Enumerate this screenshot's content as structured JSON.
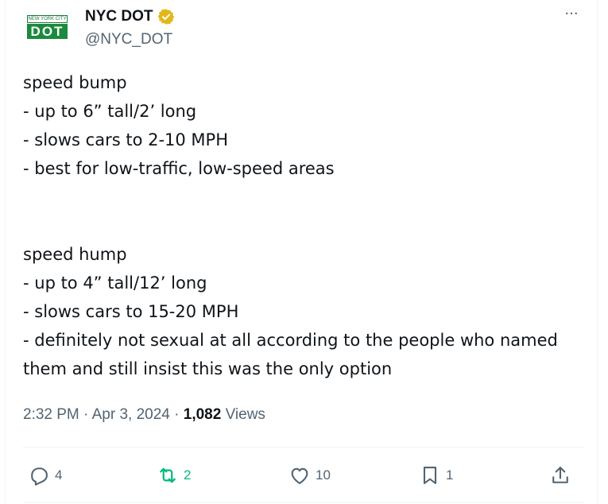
{
  "author": {
    "display_name": "NYC DOT",
    "handle": "@NYC_DOT",
    "verified_icon": "verified-badge-icon",
    "verified_color": "#e2b719",
    "avatar": {
      "top_text": "NEW YORK CITY",
      "bottom_text": "DOT"
    }
  },
  "more_label": "···",
  "tweet": {
    "text": "speed bump\n- up to 6” tall/2’ long\n- slows cars to 2-10 MPH\n- best for low-traffic, low-speed areas\n\n\nspeed hump\n- up to 4” tall/12’ long\n- slows cars to 15-20 MPH\n- definitely not sexual at all according to the people who named them and still insist this was the only option"
  },
  "meta": {
    "time": "2:32 PM",
    "separator1": " · ",
    "date": "Apr 3, 2024",
    "separator2": " · ",
    "views_count": "1,082",
    "views_label": "Views"
  },
  "actions": {
    "replies": "4",
    "retweets": "2",
    "likes": "10",
    "bookmarks": "1"
  },
  "colors": {
    "text": "#0f1419",
    "secondary": "#536471",
    "retweet_green": "#00ba7c",
    "avatar_green": "#1b8a3e"
  }
}
